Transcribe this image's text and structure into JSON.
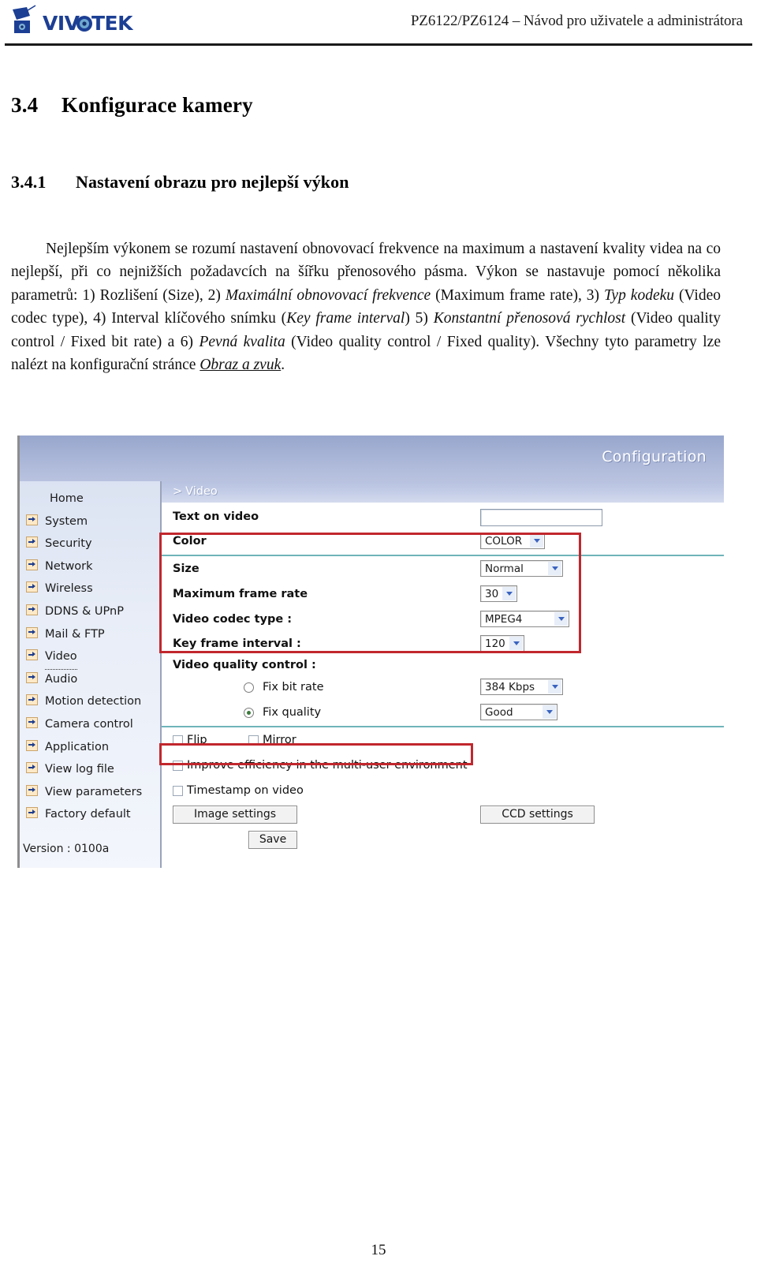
{
  "header": {
    "logo_alt": "VIVOTEK",
    "document_title": "PZ6122/PZ6124 – Návod pro uživatele a administrátora"
  },
  "section": {
    "number": "3.4",
    "title": "Konfigurace kamery"
  },
  "subsection": {
    "number": "3.4.1",
    "title": "Nastavení obrazu pro nejlepší výkon"
  },
  "paragraph": {
    "p1": "Nejlepším výkonem se rozumí nastavení obnovovací frekvence na maximum a nastavení kvality videa na co nejlepší, při co nejnižších požadavcích na šířku přenosového pásma. Výkon se nastavuje pomocí několika parametrů: 1) Rozlišení (Size), 2) ",
    "em1": "Maximální obnovovací frekvence",
    "p2": " (Maximum frame rate), 3) ",
    "em2": "Typ kodeku",
    "p3": " (Video codec type), 4) Interval klíčového snímku (",
    "em3": "Key frame interval",
    "p4": ") 5) ",
    "em4": "Konstantní přenosová rychlost",
    "p5": " (Video quality control / Fixed bit rate) a 6) ",
    "em5": "Pevná kvalita",
    "p6": " (Video quality control / Fixed quality). Všechny tyto parametry lze nalézt na konfigurační stránce ",
    "link": "Obraz a zvuk",
    "p7": "."
  },
  "ui": {
    "topbar_title": "Configuration",
    "panel_title": "Video",
    "panel_caret": ">",
    "sidebar": {
      "items": [
        {
          "label": "Home",
          "has_icon": false,
          "active": false
        },
        {
          "label": "System",
          "has_icon": true,
          "active": false
        },
        {
          "label": "Security",
          "has_icon": true,
          "active": false
        },
        {
          "label": "Network",
          "has_icon": true,
          "active": false
        },
        {
          "label": "Wireless",
          "has_icon": true,
          "active": false
        },
        {
          "label": "DDNS & UPnP",
          "has_icon": true,
          "active": false
        },
        {
          "label": "Mail & FTP",
          "has_icon": true,
          "active": false
        },
        {
          "label": "Video",
          "has_icon": true,
          "active": true
        },
        {
          "label": "Audio",
          "has_icon": true,
          "active": false
        },
        {
          "label": "Motion detection",
          "has_icon": true,
          "active": false
        },
        {
          "label": "Camera control",
          "has_icon": true,
          "active": false
        },
        {
          "label": "Application",
          "has_icon": true,
          "active": false
        },
        {
          "label": "View log file",
          "has_icon": true,
          "active": false
        },
        {
          "label": "View parameters",
          "has_icon": true,
          "active": false
        },
        {
          "label": "Factory default",
          "has_icon": true,
          "active": false
        }
      ],
      "version": "Version : 0100a"
    },
    "form": {
      "text_on_video_label": "Text on video",
      "text_on_video_value": "",
      "color_label": "Color",
      "color_value": "COLOR",
      "size_label": "Size",
      "size_value": "Normal",
      "max_frame_rate_label": "Maximum frame rate",
      "max_frame_rate_value": "30",
      "codec_label": "Video codec type :",
      "codec_value": "MPEG4",
      "key_frame_label": "Key frame interval :",
      "key_frame_value": "120",
      "quality_control_label": "Video quality control :",
      "fix_bit_rate_label": "Fix bit rate",
      "fix_bit_rate_value": "384 Kbps",
      "fix_bit_rate_selected": false,
      "fix_quality_label": "Fix quality",
      "fix_quality_value": "Good",
      "fix_quality_selected": true,
      "flip_label": "Flip",
      "flip_checked": false,
      "mirror_label": "Mirror",
      "mirror_checked": false,
      "improve_efficiency_label": "Improve efficiency in the multi-user environment",
      "improve_efficiency_checked": false,
      "timestamp_label": "Timestamp on video",
      "timestamp_checked": false,
      "image_settings_button": "Image settings",
      "ccd_settings_button": "CCD settings",
      "save_button": "Save"
    },
    "annotation_color": "#c1272d"
  },
  "footer": {
    "page_number": "15"
  }
}
